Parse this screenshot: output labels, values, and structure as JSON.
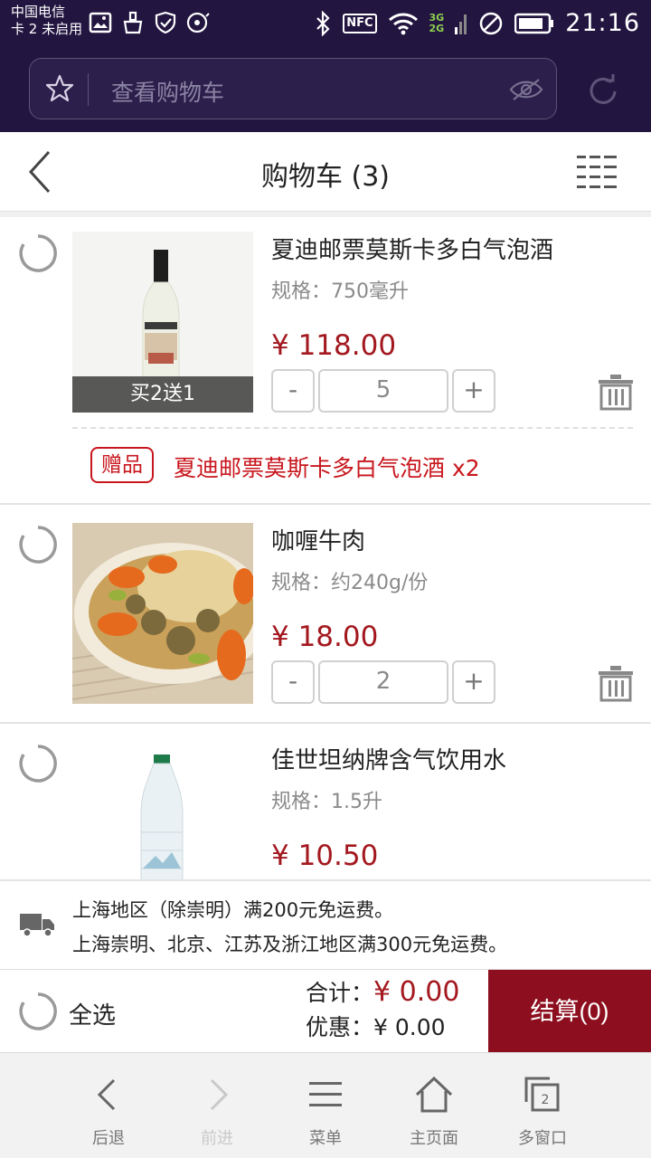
{
  "status_bar": {
    "carrier_line1": "中国电信",
    "carrier_line2": "卡 2 未启用",
    "nfc": "NFC",
    "net_3g": "3G",
    "net_2g": "2G",
    "time": "21:16",
    "icons": [
      "image-icon",
      "cleaner-icon",
      "shield-check-icon",
      "hdd-icon",
      "bluetooth-icon",
      "nfc-icon",
      "wifi-icon",
      "signal-icon",
      "no-sim-icon",
      "battery-icon"
    ]
  },
  "browser": {
    "url_placeholder": "查看购物车",
    "icons": [
      "star-icon",
      "eye-icon",
      "reload-icon"
    ]
  },
  "header": {
    "title": "购物车 (3)",
    "icons": [
      "back-icon",
      "grid-menu-icon"
    ]
  },
  "items": [
    {
      "name": "夏迪邮票莫斯卡多白气泡酒",
      "spec": "规格：750毫升",
      "price": "¥ 118.00",
      "quantity": "5",
      "promo": "买2送1",
      "gift_badge": "赠品",
      "gift_text": "夏迪邮票莫斯卡多白气泡酒 x2",
      "selected": false
    },
    {
      "name": "咖喱牛肉",
      "spec": "规格：约240g/份",
      "price": "¥ 18.00",
      "quantity": "2",
      "selected": false
    },
    {
      "name": "佳世坦纳牌含气饮用水",
      "spec": "规格：1.5升",
      "price": "¥ 10.50",
      "selected": false
    }
  ],
  "qty_controls": {
    "minus": "-",
    "plus": "+"
  },
  "shipping": {
    "line1": "上海地区（除崇明）满200元免运费。",
    "line2": "上海崇明、北京、江苏及浙江地区满300元免运费。"
  },
  "checkout": {
    "select_all": "全选",
    "total_label": "合计：",
    "total_value": "¥ 0.00",
    "discount_label": "优惠：",
    "discount_value": "¥ 0.00",
    "button": "结算(0)"
  },
  "bottom_nav": [
    {
      "label": "后退",
      "icon": "back-arrow-icon",
      "enabled": true
    },
    {
      "label": "前进",
      "icon": "forward-arrow-icon",
      "enabled": false
    },
    {
      "label": "菜单",
      "icon": "menu-icon",
      "enabled": true
    },
    {
      "label": "主页面",
      "icon": "home-icon",
      "enabled": true
    },
    {
      "label": "多窗口",
      "icon": "windows-icon",
      "enabled": true,
      "badge": "2"
    }
  ],
  "colors": {
    "status_bar_bg": "#221540",
    "price_red": "#a3181f",
    "gift_red": "#c8161d",
    "checkout_btn": "#8d0f1f"
  }
}
